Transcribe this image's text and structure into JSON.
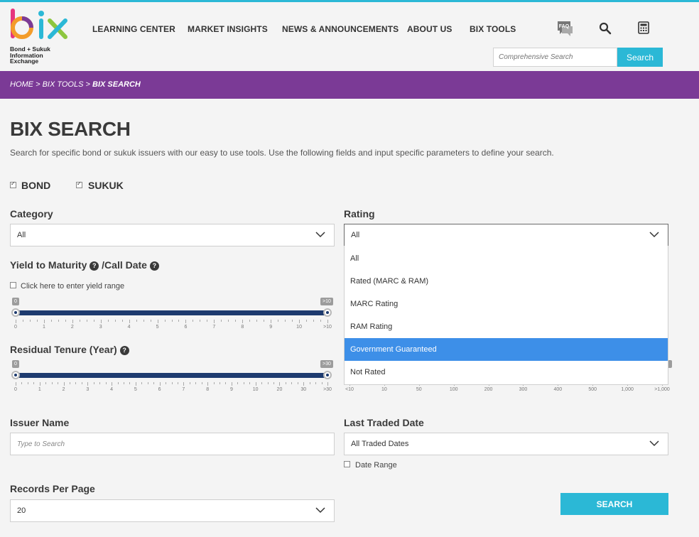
{
  "brand": {
    "logo_word": "bix",
    "logo_lines": [
      "Bond + Sukuk",
      "Information",
      "Exchange"
    ]
  },
  "nav": {
    "items": [
      "LEARNING CENTER",
      "MARKET INSIGHTS",
      "NEWS & ANNOUNCEMENTS",
      "ABOUT US",
      "BIX TOOLS"
    ],
    "icons": [
      "faq-icon",
      "search-icon",
      "calculator-icon"
    ],
    "faq_badge": "FAQ"
  },
  "header_search": {
    "placeholder": "Comprehensive Search",
    "button": "Search"
  },
  "breadcrumb": {
    "home": "HOME",
    "sep": ">",
    "tools": "BIX TOOLS",
    "current": "BIX SEARCH"
  },
  "page": {
    "title": "BIX SEARCH",
    "intro": "Search for specific bond or sukuk issuers with our easy to use tools. Use the following fields and input specific parameters to define your search."
  },
  "types": {
    "bond": {
      "label": "BOND",
      "checked": true
    },
    "sukuk": {
      "label": "SUKUK",
      "checked": true
    }
  },
  "category": {
    "label": "Category",
    "value": "All"
  },
  "rating": {
    "label": "Rating",
    "value": "All",
    "options": [
      "All",
      "Rated (MARC & RAM)",
      "MARC Rating",
      "RAM Rating",
      "Government Guaranteed",
      "Not Rated"
    ],
    "highlighted": "Government Guaranteed"
  },
  "ytm": {
    "label": "Yield to Maturity",
    "label2": "/Call Date",
    "range_check": "Click here to enter yield range",
    "min_tag": "0",
    "max_tag": ">10",
    "ticks": [
      "0",
      "1",
      "2",
      "3",
      "4",
      "5",
      "6",
      "7",
      "8",
      "9",
      "10",
      ">10"
    ]
  },
  "tenure": {
    "label": "Residual Tenure (Year)",
    "min_tag": "0",
    "max_tag": ">30",
    "ticks": [
      "0",
      "1",
      "2",
      "3",
      "4",
      "5",
      "6",
      "7",
      "8",
      "9",
      "10",
      "20",
      "30",
      ">30"
    ]
  },
  "hidden_slider": {
    "ticks": [
      "<10",
      "10",
      "50",
      "100",
      "200",
      "300",
      "400",
      "500",
      "1,000",
      ">1,000"
    ]
  },
  "issuer": {
    "label": "Issuer Name",
    "placeholder": "Type to Search"
  },
  "last_traded": {
    "label": "Last Traded Date",
    "value": "All Traded Dates",
    "date_range": "Date Range"
  },
  "records": {
    "label": "Records Per Page",
    "value": "20"
  },
  "submit": {
    "label": "SEARCH"
  },
  "colors": {
    "accent": "#2bb8d6",
    "purple": "#7b3a96",
    "slider": "#1d3a6e",
    "highlight": "#3d8fe8"
  }
}
